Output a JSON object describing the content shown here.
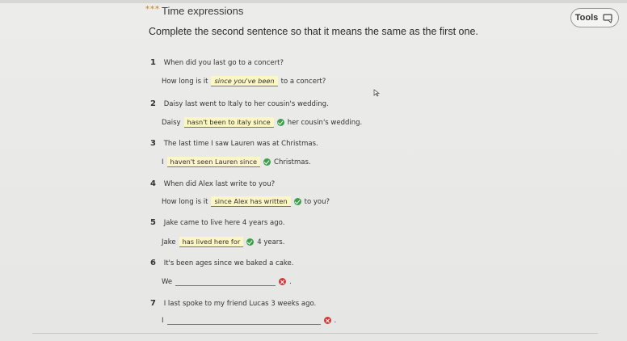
{
  "header": {
    "dots": "***",
    "section_title": "Time expressions",
    "tools_label": "Tools"
  },
  "instruction": "Complete the second sentence so that it means the same as the first one.",
  "questions": [
    {
      "num": "1",
      "prompt": "When did you last go to a concert?",
      "before": "How long is it",
      "answer": "since you've been",
      "after": "to a concert?",
      "status": "none"
    },
    {
      "num": "2",
      "prompt": "Daisy last went to Italy to her cousin's wedding.",
      "before": "Daisy",
      "answer": "hasn't been to italy since",
      "after": "her cousin's wedding.",
      "status": "correct"
    },
    {
      "num": "3",
      "prompt": "The last time I saw Lauren was at Christmas.",
      "before": "I",
      "answer": "haven't seen Lauren since",
      "after": "Christmas.",
      "status": "correct"
    },
    {
      "num": "4",
      "prompt": "When did Alex last write to you?",
      "before": "How long is it",
      "answer": "since Alex has written",
      "after": "to you?",
      "status": "correct"
    },
    {
      "num": "5",
      "prompt": "Jake came to live here 4 years ago.",
      "before": "Jake",
      "answer": "has lived here for",
      "after": "4 years.",
      "status": "correct"
    },
    {
      "num": "6",
      "prompt": "It's been ages since we baked a cake.",
      "before": "We",
      "answer": "",
      "after": ".",
      "status": "wrong"
    },
    {
      "num": "7",
      "prompt": "I last spoke to my friend Lucas 3 weeks ago.",
      "before": "I",
      "answer": "",
      "after": ".",
      "status": "wrong"
    }
  ],
  "colors": {
    "correct": "#3aa04a",
    "wrong": "#d23a3a",
    "fill": "#fbf6c4"
  }
}
